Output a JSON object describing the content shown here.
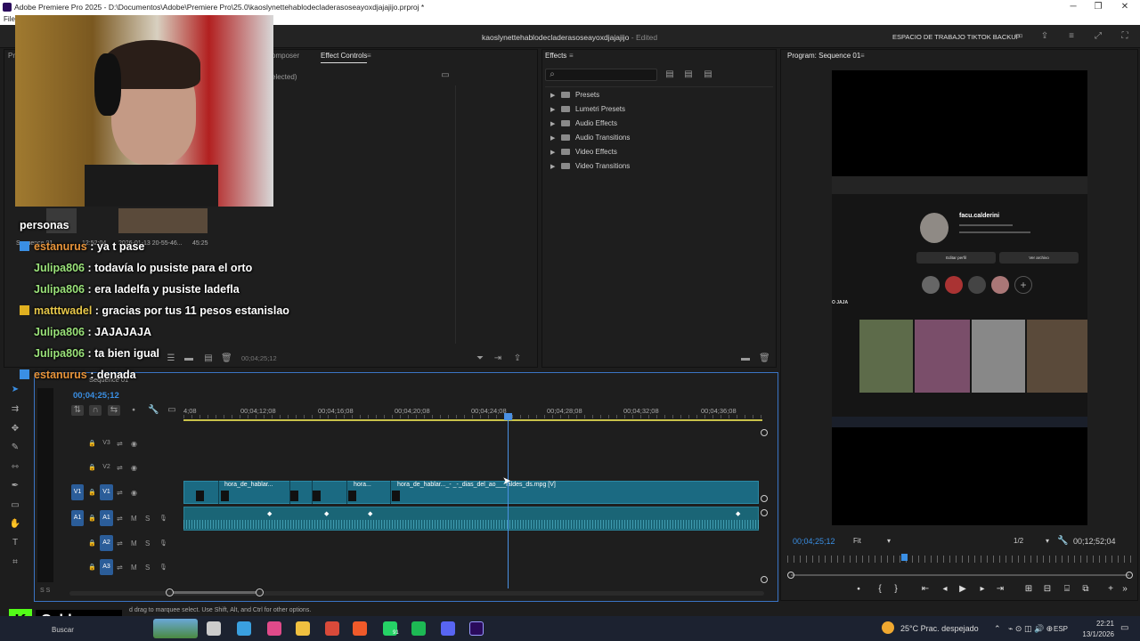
{
  "window": {
    "title": "Adobe Premiere Pro 2025 - D:\\Documentos\\Adobe\\Premiere Pro\\25.0\\kaoslynettehablodecladerasoseayoxdjajajijo.prproj *",
    "menu_first": "File"
  },
  "header": {
    "project_name": "kaoslynettehablodecladerasoseayoxdjajajijo",
    "edited_label": "- Edited",
    "workspace": "ESPACIO DE TRABAJO TIKTOK BACKUP"
  },
  "source_panel": {
    "tab1": "Pr",
    "tab2": "omposer",
    "tab_effect_controls": "Effect Controls",
    "no_selection": "elected)",
    "timecode": "00;04;25;12"
  },
  "effects": {
    "tab": "Effects",
    "search_placeholder": "",
    "items": [
      "Presets",
      "Lumetri Presets",
      "Audio Effects",
      "Audio Transitions",
      "Video Effects",
      "Video Transitions"
    ]
  },
  "program": {
    "tab": "Program: Sequence 01",
    "timecode": "00;04;25;12",
    "fit": "Fit",
    "quality": "1/2",
    "duration": "00;12;52;04"
  },
  "preview": {
    "profile_name": "facu.calderini",
    "edit_profile": "Editar perfil",
    "view_archive": "Ver archivo",
    "jaja": "O JAJA"
  },
  "project_bin": {
    "seq_name": "Sequence 01",
    "seq_time": "12:52:04",
    "clip_name": "2026-01-13 20-55-46...",
    "clip_time": "45:25"
  },
  "timeline": {
    "seq_tab": "Sequence 01",
    "timecode": "00;04;25;12",
    "ruler": [
      "4;08",
      "00;04;12;08",
      "00;04;16;08",
      "00;04;20;08",
      "00;04;24;08",
      "00;04;28;08",
      "00;04;32;08",
      "00;04;36;08"
    ],
    "tracks": [
      {
        "name": "V3"
      },
      {
        "name": "V2"
      },
      {
        "name": "V1",
        "src": "V1"
      },
      {
        "name": "A1",
        "src": "A1"
      },
      {
        "name": "A2"
      },
      {
        "name": "A3"
      }
    ],
    "clips": [
      "hora_de_hablar...",
      "hora...",
      "hora_de_hablar..._- _-_dias_del_ao___laldes_ds.mpg [V]"
    ],
    "track_m": "M",
    "track_s": "S"
  },
  "status": {
    "hint": "d drag to marquee select. Use Shift, Alt, and Ctrl for other options."
  },
  "chat": [
    {
      "user": "",
      "msg": "personas",
      "color": "#ffffff"
    },
    {
      "user": "estanurus",
      "msg": ": ya t pase",
      "color": "#e8943a"
    },
    {
      "user": "Julipa806",
      "msg": ": todavía lo pusiste para el orto",
      "color": "#9be37a"
    },
    {
      "user": "Julipa806",
      "msg": ": era ladelfa y pusiste ladefla",
      "color": "#9be37a"
    },
    {
      "user": "matttwadel",
      "msg": ": gracias por tus 11 pesos estanislao",
      "color": "#e8c84a"
    },
    {
      "user": "Julipa806",
      "msg": ": JAJAJAJA",
      "color": "#9be37a"
    },
    {
      "user": "Julipa806",
      "msg": ": ta bien igual",
      "color": "#9be37a"
    },
    {
      "user": "estanurus",
      "msg": ": denada",
      "color": "#e8943a"
    }
  ],
  "streamer_name": "Caldeerass",
  "taskbar": {
    "search": "Buscar",
    "weather": "25°C  Prac. despejado",
    "lang": "ESP",
    "time": "22:21",
    "date": "13/1/2026",
    "wa_badge": "91"
  }
}
